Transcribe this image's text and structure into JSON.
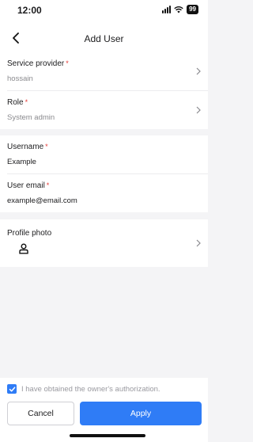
{
  "status": {
    "time": "12:00",
    "battery": "99"
  },
  "nav": {
    "title": "Add User"
  },
  "form": {
    "service_provider": {
      "label": "Service provider",
      "required": "*",
      "value": "hossain"
    },
    "role": {
      "label": "Role",
      "required": "*",
      "value": "System admin"
    },
    "username": {
      "label": "Username",
      "required": "*",
      "value": "Example"
    },
    "email": {
      "label": "User email",
      "required": "*",
      "value": "example@email.com"
    },
    "photo": {
      "label": "Profile photo",
      "icon": "person-icon"
    }
  },
  "footer": {
    "authorization": "I have obtained the owner's authorization.",
    "authorization_checked": true,
    "cancel_label": "Cancel",
    "apply_label": "Apply"
  },
  "colors": {
    "accent": "#2f7cf6",
    "required": "#e53935"
  }
}
